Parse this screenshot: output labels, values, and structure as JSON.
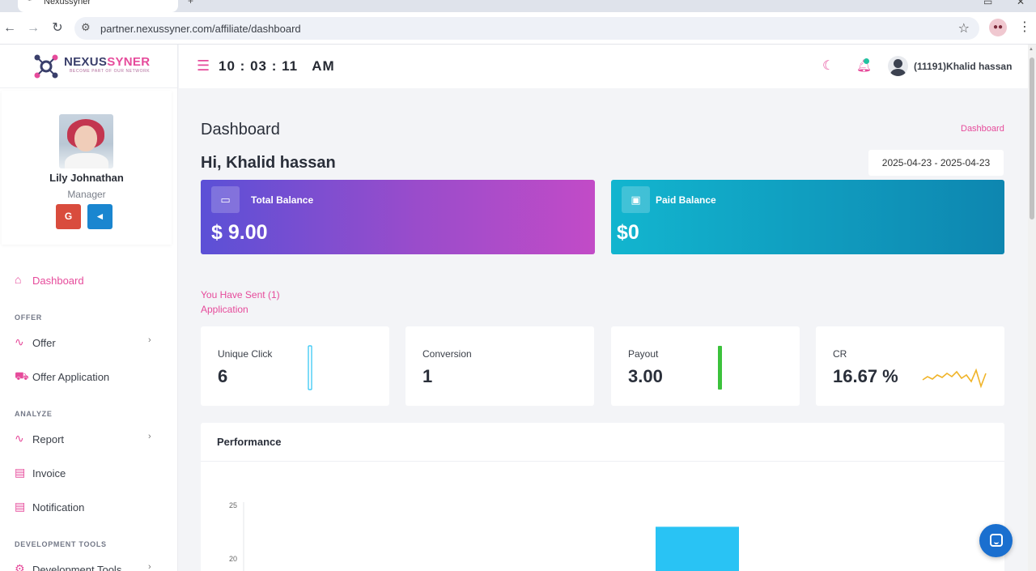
{
  "browser": {
    "tab_title": "Nexussyner",
    "url": "partner.nexussyner.com/affiliate/dashboard"
  },
  "brand": {
    "name_part1": "NEXUS",
    "name_part2": "SYNER",
    "tagline": "BECOME PART OF OUR NETWORK"
  },
  "profile": {
    "name": "Lily Johnathan",
    "role": "Manager",
    "google_label": "G",
    "telegram_label": "◄"
  },
  "sidebar": {
    "dashboard": "Dashboard",
    "section_offer": "OFFER",
    "offer": "Offer",
    "offer_application": "Offer Application",
    "section_analyze": "ANALYZE",
    "report": "Report",
    "invoice": "Invoice",
    "notification": "Notification",
    "section_dev": "DEVELOPMENT TOOLS",
    "dev_tools": "Development Tools"
  },
  "header": {
    "clock_h": "10",
    "clock_m": "03",
    "clock_s": "11",
    "clock_sep": ":",
    "clock_ampm": "AM",
    "user": "(11191)Khalid hassan"
  },
  "main": {
    "title": "Dashboard",
    "breadcrumb": "Dashboard",
    "greeting": "Hi, Khalid hassan",
    "date_range": "2025-04-23 - 2025-04-23",
    "total_balance_label": "Total Balance",
    "total_balance_value": "$ 9.00",
    "paid_balance_label": "Paid Balance",
    "paid_balance_value": "$0",
    "sent_note": "You Have Sent (1) Application"
  },
  "stats": [
    {
      "label": "Unique Click",
      "value": "6"
    },
    {
      "label": "Conversion",
      "value": "1"
    },
    {
      "label": "Payout",
      "value": "3.00"
    },
    {
      "label": "CR",
      "value": "16.67 %"
    }
  ],
  "performance": {
    "title": "Performance"
  },
  "chart_data": {
    "type": "bar",
    "title": "Performance",
    "categories": [
      ""
    ],
    "series": [
      {
        "values": [
          23
        ]
      }
    ],
    "y_ticks": [
      20,
      25
    ],
    "ylim": [
      0,
      25
    ],
    "color": "#29c3f4"
  },
  "colors": {
    "accent": "#e64b9b",
    "total_balance_gradient": [
      "#5b50d6",
      "#c24bc7"
    ],
    "paid_balance_gradient": [
      "#12b5cf",
      "#0e86b0"
    ]
  }
}
